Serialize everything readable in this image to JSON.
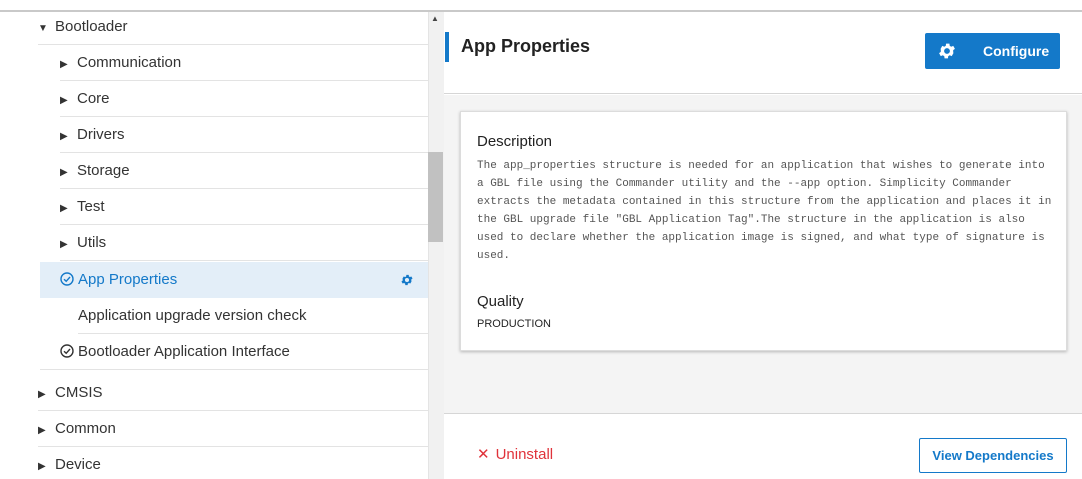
{
  "tree": {
    "bootloader": "Bootloader",
    "communication": "Communication",
    "core": "Core",
    "drivers": "Drivers",
    "storage": "Storage",
    "test": "Test",
    "utils": "Utils",
    "app_properties": "App Properties",
    "app_upgrade_check": "Application upgrade version check",
    "bootloader_app_interface": "Bootloader Application Interface",
    "cmsis": "CMSIS",
    "common": "Common",
    "device": "Device",
    "expanded_icon": "caret-down-icon",
    "collapsed_icon": "caret-right-icon",
    "installed_icon": "check-circle-icon",
    "configure_icon": "gear-icon"
  },
  "header": {
    "title": "App Properties",
    "configure_label": "Configure"
  },
  "details": {
    "description_heading": "Description",
    "description_text": "The app_properties structure is needed for an application that wishes to generate into a GBL file using the Commander utility and the --app option. Simplicity Commander extracts the metadata contained in this structure from the application and places it in the GBL upgrade file \"GBL Application Tag\".The structure in the application is also used to declare whether the application image is signed, and what type of signature is used.",
    "quality_heading": "Quality",
    "quality_value": "PRODUCTION"
  },
  "footer": {
    "uninstall_label": "Uninstall",
    "uninstall_icon": "x-icon",
    "view_dependencies_label": "View Dependencies"
  },
  "colors": {
    "accent": "#1479c9",
    "selected_bg": "#e3eef8",
    "danger": "#e0333b"
  }
}
